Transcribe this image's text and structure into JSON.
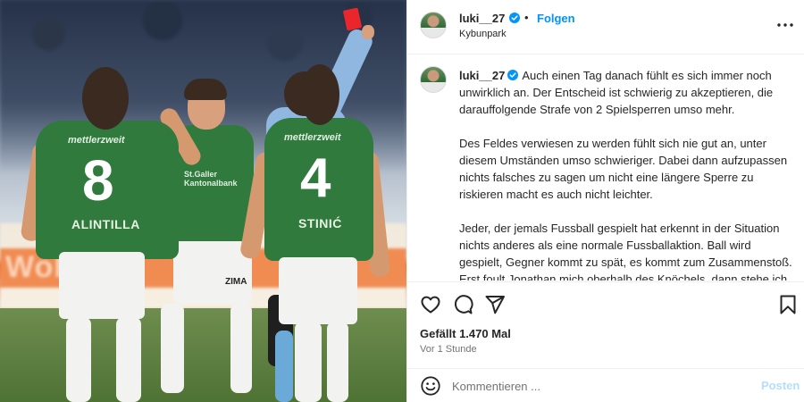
{
  "post": {
    "username": "luki__27",
    "follow_label": "Folgen",
    "separator": "•",
    "location": "Kybunpark"
  },
  "photo": {
    "adboard_text": "Woh",
    "players": [
      {
        "number": "8",
        "name": "ALINTILLA",
        "sponsor": "mettlerzweit"
      },
      {
        "number": "4",
        "name": "STINIĆ",
        "sponsor": "mettlerzweit"
      },
      {
        "sponsor": "St.Galler Kantonalbank"
      }
    ],
    "shorts_text": "ZIMA"
  },
  "caption": {
    "username": "luki__27",
    "paragraphs": [
      "Auch einen Tag danach fühlt es sich immer noch unwirklich an. Der Entscheid ist schwierig zu akzeptieren, die darauffolgende Strafe von 2 Spielsperren umso mehr.",
      "Des Feldes verwiesen zu werden fühlt sich nie gut an, unter diesem Umständen umso schwieriger. Dabei dann aufzupassen nichts falsches zu sagen um nicht eine längere Sperre zu riskieren macht es auch nicht leichter.",
      "Jeder, der jemals Fussball gespielt hat erkennt in der Situation nichts anderes als eine normale Fussballaktion. Ball wird gespielt, Gegner kommt zu spät, es kommt zum Zusammenstoß. Erst foult Jonathan mich oberhalb des Knöchels, dann stehe ich ihm unglücklich auf der Wade. Beide Spieler klatschen sich ab, checken ob es dem anderen gut geht und weiter geht's"
    ]
  },
  "actions": {
    "likes_text": "Gefällt 1.470 Mal",
    "time_text": "Vor 1 Stunde",
    "icons": [
      "heart-icon",
      "comment-icon",
      "share-icon",
      "bookmark-icon"
    ]
  },
  "comment": {
    "placeholder": "Kommentieren ...",
    "post_label": "Posten"
  },
  "colors": {
    "link_blue": "#0095f6",
    "disabled_blue": "#b2dffc",
    "verified_blue": "#0095f6",
    "jersey_green": "#2f7a3c"
  }
}
